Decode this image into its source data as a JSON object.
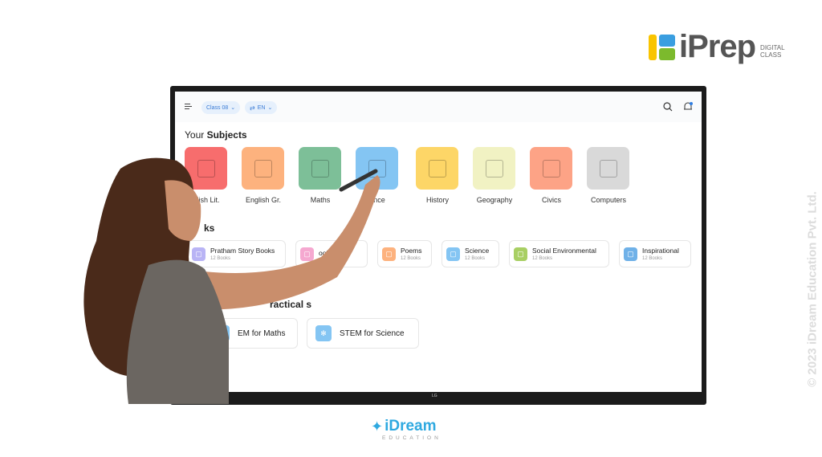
{
  "brand": {
    "logo_text": "iPrep",
    "logo_sub1": "DIGITAL",
    "logo_sub2": "CLASS",
    "footer_logo": "iDream",
    "footer_sub": "EDUCATION",
    "copyright": "© 2023 iDream Education Pvt. Ltd.",
    "tv_brand": "LG"
  },
  "header": {
    "menu_icon": "hamburger-icon",
    "class_label": "Class 08",
    "lang_label": "EN",
    "search_icon": "search-icon",
    "bell_icon": "bell-icon"
  },
  "subjects": {
    "title_prefix": "Your ",
    "title_bold": "Subjects",
    "items": [
      {
        "label": "glish Lit.",
        "color": "#f76d6d",
        "icon": "quill-icon"
      },
      {
        "label": "English Gr.",
        "color": "#fdb27e",
        "icon": "book-ab-icon"
      },
      {
        "label": "Maths",
        "color": "#7dbf98",
        "icon": "calculator-icon"
      },
      {
        "label": "ence",
        "color": "#84c5f3",
        "icon": "atom-icon"
      },
      {
        "label": "History",
        "color": "#fdd667",
        "icon": "scroll-icon"
      },
      {
        "label": "Geography",
        "color": "#f1f2c3",
        "icon": "globe-icon"
      },
      {
        "label": "Civics",
        "color": "#fda386",
        "icon": "institution-icon"
      },
      {
        "label": "Computers",
        "color": "#d9d9d9",
        "icon": "monitor-icon"
      }
    ]
  },
  "books": {
    "title": "ks",
    "items": [
      {
        "title": "Pratham Story Books",
        "count": "12 Books",
        "color": "#b9b4f5"
      },
      {
        "title": "ooks",
        "count": "",
        "color": "#f5a8d0"
      },
      {
        "title": "Poems",
        "count": "12 Books",
        "color": "#fdb27e"
      },
      {
        "title": "Science",
        "count": "12 Books",
        "color": "#84c5f3"
      },
      {
        "title": "Social Environmental",
        "count": "12 Books",
        "color": "#a8cf63"
      },
      {
        "title": "Inspirational",
        "count": "12 Books",
        "color": "#6fb1e8"
      }
    ]
  },
  "practicals": {
    "title": "ractical s",
    "items": [
      {
        "title": "EM for Maths",
        "color": "#84c5f3"
      },
      {
        "title": "STEM for Science",
        "color": "#84c5f3"
      }
    ]
  }
}
